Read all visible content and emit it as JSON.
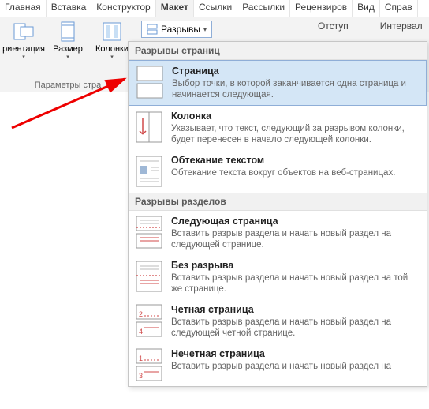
{
  "tabs": {
    "home": "Главная",
    "insert": "Вставка",
    "design": "Конструктор",
    "layout": "Макет",
    "refs": "Ссылки",
    "mail": "Рассылки",
    "review": "Рецензиров",
    "view": "Вид",
    "help": "Справ"
  },
  "ribbon": {
    "orientation": "риентация",
    "size": "Размер",
    "columns": "Колонки",
    "pageSetup": "Параметры стра",
    "breaks": "Разрывы",
    "indent": "Отступ",
    "interval": "Интервал"
  },
  "dropdown": {
    "header1": "Разрывы страниц",
    "header2": "Разрывы разделов",
    "items": [
      {
        "title": "Страница",
        "desc": "Выбор точки, в которой заканчивается одна страница и начинается следующая."
      },
      {
        "title": "Колонка",
        "desc": "Указывает, что текст, следующий за разрывом колонки, будет перенесен в начало следующей колонки."
      },
      {
        "title": "Обтекание текстом",
        "desc": "Обтекание текста вокруг объектов на веб-страницах."
      },
      {
        "title": "Следующая страница",
        "desc": "Вставить разрыв раздела и начать новый раздел на следующей странице."
      },
      {
        "title": "Без разрыва",
        "desc": "Вставить разрыв раздела и начать новый раздел на той же странице."
      },
      {
        "title": "Четная страница",
        "desc": "Вставить разрыв раздела и начать новый раздел на следующей четной странице."
      },
      {
        "title": "Нечетная страница",
        "desc": "Вставить разрыв раздела и начать новый раздел на"
      }
    ]
  }
}
